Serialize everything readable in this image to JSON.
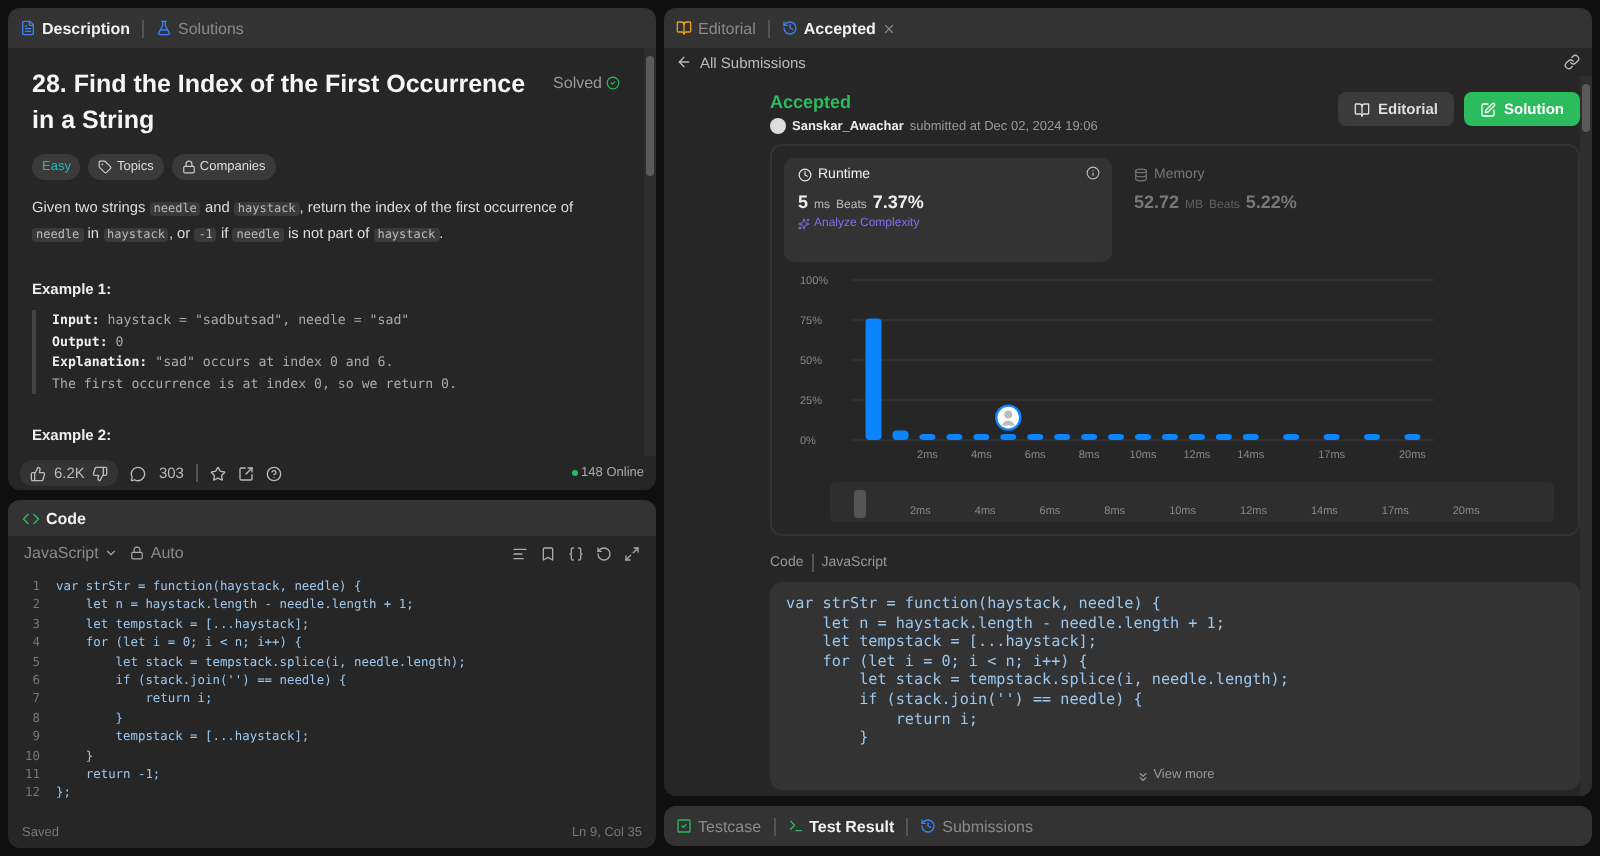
{
  "left_tabs": [
    {
      "label": "Description",
      "selected": true
    },
    {
      "label": "Solutions",
      "selected": false
    }
  ],
  "problem": {
    "title": "28. Find the Index of the First Occurrence in a String",
    "status": "Solved",
    "tags": [
      {
        "label": "Easy",
        "kind": "difficulty"
      },
      {
        "label": "Topics",
        "kind": "topics"
      },
      {
        "label": "Companies",
        "kind": "companies"
      }
    ],
    "description": [
      {
        "text": "Given two strings ",
        "code": false
      },
      {
        "text": "needle",
        "code": true
      },
      {
        "text": " and ",
        "code": false
      },
      {
        "text": "haystack",
        "code": true
      },
      {
        "text": ", return the index of the first occurrence of ",
        "code": false
      },
      {
        "text": "needle",
        "code": true
      },
      {
        "text": " in ",
        "code": false
      },
      {
        "text": "haystack",
        "code": true
      },
      {
        "text": ", or ",
        "code": false
      },
      {
        "text": "-1",
        "code": true
      },
      {
        "text": " if ",
        "code": false
      },
      {
        "text": "needle",
        "code": true
      },
      {
        "text": " is not part of ",
        "code": false
      },
      {
        "text": "haystack",
        "code": true
      },
      {
        "text": ".",
        "code": false
      }
    ],
    "examples": [
      {
        "title": "Example 1:",
        "lines": [
          "**Input:** haystack = \"sadbutsad\", needle = \"sad\"",
          "**Output:** 0",
          "**Explanation:** \"sad\" occurs at index 0 and 6.",
          "The first occurrence is at index 0, so we return 0."
        ]
      },
      {
        "title": "Example 2:"
      }
    ]
  },
  "actions": {
    "likes": "6.2K",
    "comments": "303",
    "online": "148 Online"
  },
  "editor": {
    "title": "Code",
    "language": "JavaScript",
    "mode": "Auto",
    "status": "Saved",
    "cursor": "Ln 9, Col 35",
    "lines": [
      {
        "n": "1",
        "text": "var strStr = function(haystack, needle) {"
      },
      {
        "n": "2",
        "text": "    let n = haystack.length - needle.length + 1;"
      },
      {
        "n": "3",
        "text": "    let tempstack = [...haystack];"
      },
      {
        "n": "4",
        "text": "    for (let i = 0; i < n; i++) {"
      },
      {
        "n": "5",
        "text": "        let stack = tempstack.splice(i, needle.length);"
      },
      {
        "n": "6",
        "text": "        if (stack.join('') == needle) {"
      },
      {
        "n": "7",
        "text": "            return i;"
      },
      {
        "n": "8",
        "text": "        }"
      },
      {
        "n": "9",
        "text": "        tempstack = [...haystack];"
      },
      {
        "n": "10",
        "text": "    }"
      },
      {
        "n": "11",
        "text": "    return -1;"
      },
      {
        "n": "12",
        "text": "};"
      }
    ]
  },
  "right_tabs": [
    {
      "label": "Editorial",
      "selected": false,
      "closable": false
    },
    {
      "label": "Accepted",
      "selected": true,
      "closable": true
    }
  ],
  "back_link": "All Submissions",
  "submission": {
    "status": "Accepted",
    "user": "Sanskar_Awachar",
    "submitted": "submitted at Dec 02, 2024 19:06",
    "buttons": [
      {
        "label": "Editorial",
        "kind": "secondary"
      },
      {
        "label": "Solution",
        "kind": "primary"
      }
    ],
    "stats": [
      {
        "kind": "runtime",
        "title": "Runtime",
        "value": "5",
        "unit": "ms",
        "beats_label": "Beats",
        "beats": "7.37%",
        "selected": true,
        "link": "Analyze Complexity"
      },
      {
        "kind": "memory",
        "title": "Memory",
        "value": "52.72",
        "unit": "MB",
        "beats_label": "Beats",
        "beats": "5.22%",
        "selected": false
      }
    ],
    "chart_data": {
      "type": "bar",
      "x": [
        0,
        1,
        2,
        3,
        4,
        5,
        6,
        7,
        8,
        9,
        10,
        11,
        12,
        13,
        14,
        15.5,
        17,
        18.5,
        20
      ],
      "xlim": [
        -0.8,
        20.8
      ],
      "grid": true,
      "values": [
        76,
        6,
        2,
        2,
        2,
        2,
        2,
        2,
        2,
        2,
        2,
        2,
        2,
        2,
        2,
        2,
        2,
        2,
        2
      ],
      "ylim": [
        0,
        100
      ],
      "yticks": [
        {
          "value": 0,
          "label": "0%"
        },
        {
          "value": 25,
          "label": "25%"
        },
        {
          "value": 50,
          "label": "50%"
        },
        {
          "value": 75,
          "label": "75%"
        },
        {
          "value": 100,
          "label": "100%"
        }
      ],
      "xticks": [
        {
          "value": 2,
          "label": "2ms"
        },
        {
          "value": 4,
          "label": "4ms"
        },
        {
          "value": 6,
          "label": "6ms"
        },
        {
          "value": 8,
          "label": "8ms"
        },
        {
          "value": 10,
          "label": "10ms"
        },
        {
          "value": 12,
          "label": "12ms"
        },
        {
          "value": 14,
          "label": "14ms"
        },
        {
          "value": 17,
          "label": "17ms"
        },
        {
          "value": 20,
          "label": "20ms"
        }
      ]
    },
    "overview_labels": [
      "2ms",
      "4ms",
      "6ms",
      "8ms",
      "10ms",
      "12ms",
      "14ms",
      "17ms",
      "20ms"
    ],
    "code_label": "Code",
    "code_language": "JavaScript",
    "code_lines": [
      "var strStr = function(haystack, needle) {",
      "    let n = haystack.length - needle.length + 1;",
      "    let tempstack = [...haystack];",
      "    for (let i = 0; i < n; i++) {",
      "        let stack = tempstack.splice(i, needle.length);",
      "        if (stack.join('') == needle) {",
      "            return i;",
      "        }"
    ],
    "view_more": "View more"
  },
  "bottom_tabs": [
    {
      "label": "Testcase",
      "selected": false
    },
    {
      "label": "Test Result",
      "selected": true
    },
    {
      "label": "Submissions",
      "selected": false
    }
  ]
}
